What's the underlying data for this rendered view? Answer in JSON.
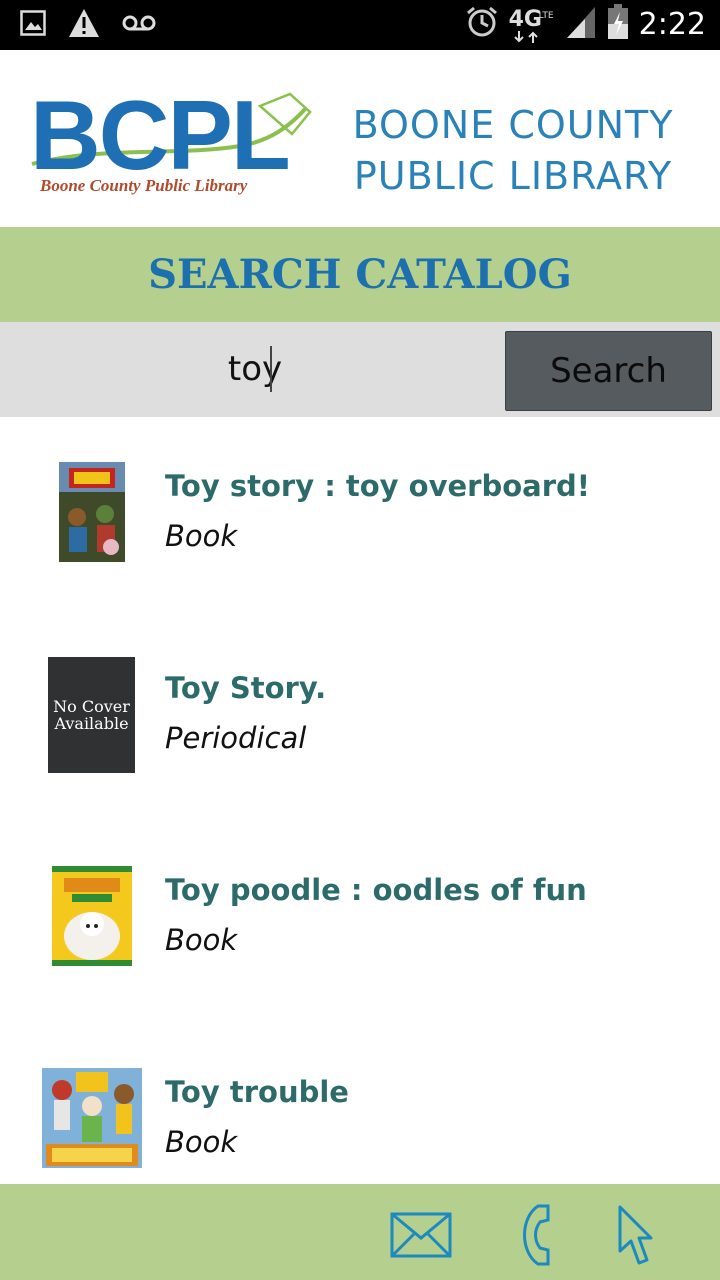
{
  "status_bar": {
    "time": "2:22",
    "network": "4G",
    "network_sub": "LTE",
    "icons": [
      "image-icon",
      "warning-icon",
      "voicemail-icon",
      "alarm-icon",
      "signal-icon",
      "battery-icon"
    ]
  },
  "header": {
    "logo_letters": "BCPL",
    "logo_tagline": "Boone County Public Library",
    "library_name_line1": "BOONE COUNTY",
    "library_name_line2": "PUBLIC LIBRARY"
  },
  "page_title": "SEARCH CATALOG",
  "search": {
    "value": "toy",
    "button_label": "Search"
  },
  "results": [
    {
      "title": "Toy story : toy overboard!",
      "format": "Book",
      "cover": "toy-story-cover"
    },
    {
      "title": "Toy Story.",
      "format": "Periodical",
      "cover": "no-cover",
      "cover_text_1": "No Cover",
      "cover_text_2": "Available"
    },
    {
      "title": "Toy poodle : oodles of fun",
      "format": "Book",
      "cover": "toy-poodle-cover"
    },
    {
      "title": "Toy trouble",
      "format": "Book",
      "cover": "toy-trouble-cover"
    }
  ],
  "footer": {
    "icons": [
      "mail-icon",
      "phone-icon",
      "cursor-icon"
    ]
  },
  "colors": {
    "accent_green": "#b5cf8e",
    "brand_blue": "#1c70ad",
    "title_teal": "#2d6b6b",
    "search_button": "#565b60"
  }
}
